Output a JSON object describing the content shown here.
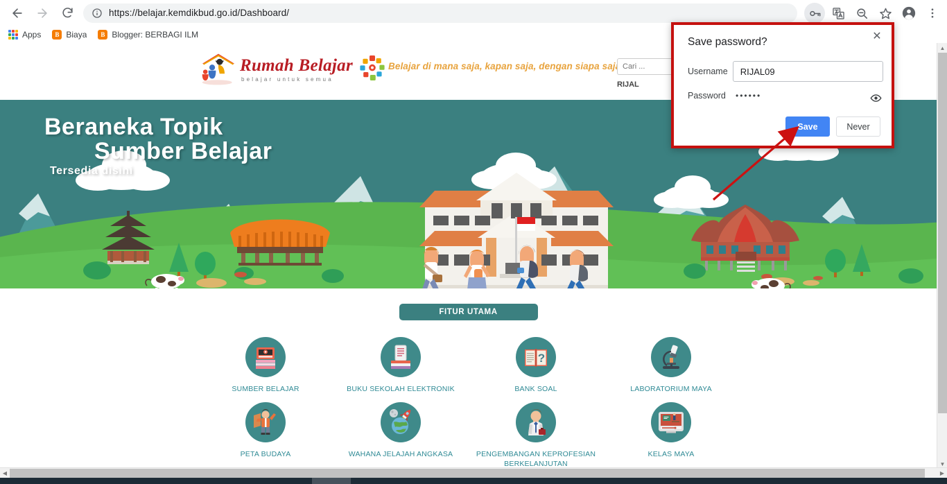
{
  "browser": {
    "nav": {
      "back_icon": "arrow-left-icon",
      "forward_icon": "arrow-right-icon",
      "reload_icon": "reload-icon"
    },
    "omnibox": {
      "info_icon": "info-circle-icon",
      "scheme": "https://",
      "host": "belajar.kemdikbud.go.id",
      "path": "/Dashboard/",
      "full_url": "https://belajar.kemdikbud.go.id/Dashboard/"
    },
    "toolbar_icons": [
      {
        "name": "key-icon",
        "label": "Save password",
        "active": true
      },
      {
        "name": "translate-icon",
        "label": "Translate this page",
        "active": false
      },
      {
        "name": "zoom-out-icon",
        "label": "Zoom out",
        "active": false
      },
      {
        "name": "star-icon",
        "label": "Bookmark this page",
        "active": false
      },
      {
        "name": "profile-avatar-icon",
        "label": "Profile",
        "active": false
      },
      {
        "name": "three-dot-menu-icon",
        "label": "Customize and control",
        "active": false
      }
    ],
    "bookmarks": [
      {
        "label": "Apps",
        "icon": "apps-grid-icon"
      },
      {
        "label": "Biaya",
        "icon": "blogger-icon"
      },
      {
        "label": "Blogger: BERBAGI ILM",
        "icon": "blogger-icon"
      }
    ]
  },
  "password_dialog": {
    "title": "Save password?",
    "close_icon": "close-icon",
    "username_label": "Username",
    "username_value": "RIJAL09",
    "password_label": "Password",
    "password_masked": "••••••",
    "reveal_icon": "eye-icon",
    "save_label": "Save",
    "never_label": "Never",
    "border_color": "#c5110f",
    "save_button_color": "#4285f4"
  },
  "annotation": {
    "arrow_color": "#cc1111",
    "arrow_target": "Save"
  },
  "site": {
    "logo": {
      "title": "Rumah Belajar",
      "subtitle": "belajar untuk semua",
      "title_color": "#b81d24"
    },
    "tagline": "Belajar di mana saja, kapan saja, dengan siapa saja",
    "tagline_color": "#e8a33d",
    "search": {
      "placeholder": "Cari ...",
      "value": ""
    },
    "user_display": "RIJAL"
  },
  "banner": {
    "line1": "Beraneka Topik",
    "line2": "Sumber Belajar",
    "line3": "Tersedia disini",
    "bg_color": "#3b8080",
    "hill_color": "#5cb85c"
  },
  "features_section": {
    "heading": "FITUR UTAMA",
    "heading_bg": "#3b8080",
    "label_color": "#2f8a95",
    "circle_color": "#3f8a8a",
    "items": [
      {
        "label": "SUMBER BELAJAR",
        "icon": "video-books-icon"
      },
      {
        "label": "BUKU SEKOLAH ELEKTRONIK",
        "icon": "tablet-books-icon"
      },
      {
        "label": "BANK SOAL",
        "icon": "open-book-question-icon"
      },
      {
        "label": "LABORATORIUM MAYA",
        "icon": "microscope-icon"
      },
      {
        "label": "PETA BUDAYA",
        "icon": "person-map-icon"
      },
      {
        "label": "WAHANA JELAJAH ANGKASA",
        "icon": "planet-rocket-icon"
      },
      {
        "label": "PENGEMBANGAN KEPROFESIAN BERKELANJUTAN",
        "icon": "teacher-icon"
      },
      {
        "label": "KELAS MAYA",
        "icon": "screen-classroom-icon"
      }
    ]
  },
  "scrollbars": {
    "vertical_up": "▲",
    "vertical_down": "▼",
    "horizontal_left": "◀",
    "horizontal_right": "▶"
  }
}
